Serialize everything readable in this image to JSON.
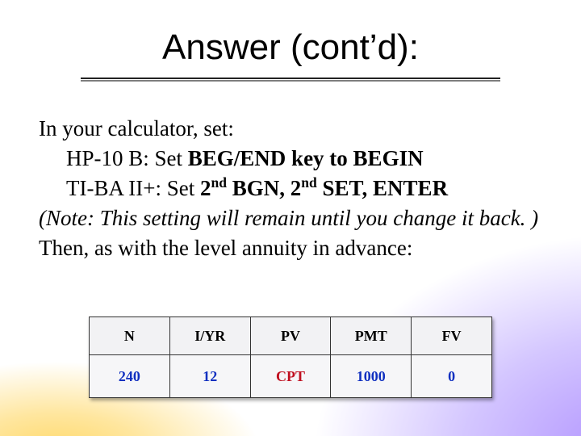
{
  "title": "Answer (cont’d):",
  "body": {
    "line1": "In your calculator, set:",
    "hp_label": "HP-10 B: Set ",
    "hp_bold": "BEG/END key to BEGIN",
    "ti_label": "TI-BA II+: Set ",
    "ti_b1": "2",
    "ti_b1_sup": "nd",
    "ti_b2": " BGN, 2",
    "ti_b2_sup": "nd",
    "ti_b3": " SET, ENTER",
    "note": "(Note: This setting will remain until you change it back. )",
    "then": "Then, as with the level annuity in advance:"
  },
  "table": {
    "headers": [
      "N",
      "I/YR",
      "PV",
      "PMT",
      "FV"
    ],
    "row": [
      "240",
      "12",
      "CPT",
      "1000",
      "0"
    ]
  },
  "chart_data": {
    "type": "table",
    "headers": [
      "N",
      "I/YR",
      "PV",
      "PMT",
      "FV"
    ],
    "rows": [
      {
        "N": 240,
        "I/YR": 12,
        "PV": "CPT",
        "PMT": 1000,
        "FV": 0
      }
    ],
    "title": "Answer (cont’d):"
  }
}
